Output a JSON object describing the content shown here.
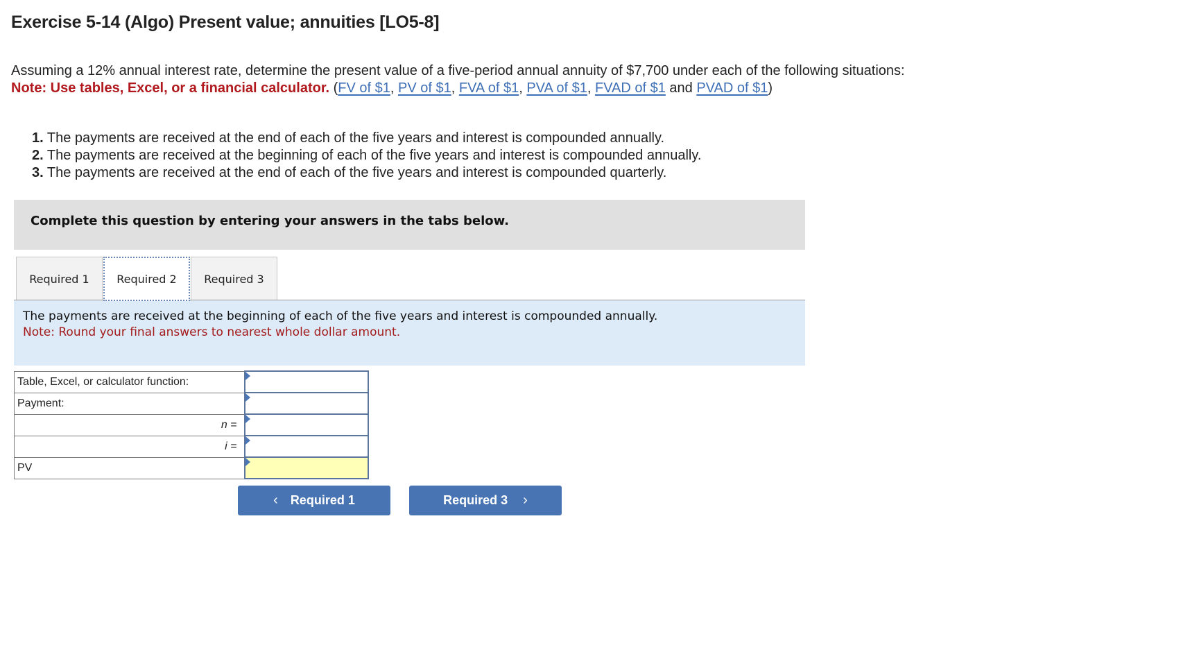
{
  "header": {
    "title": "Exercise 5-14 (Algo) Present value; annuities [LO5-8]"
  },
  "intro": {
    "text": "Assuming a 12% annual interest rate, determine the present value of a five-period annual annuity of $7,700 under each of the following situations:",
    "note_label": "Note: Use tables, Excel, or a financial calculator.",
    "open_paren": " (",
    "links": [
      "FV of $1",
      "PV of $1",
      "FVA of $1",
      "PVA of $1",
      "FVAD of $1",
      "PVAD of $1"
    ],
    "separator": ", ",
    "and_text": " and ",
    "close_paren": ")"
  },
  "requirements": [
    {
      "num": "1.",
      "text": " The payments are received at the end of each of the five years and interest is compounded annually."
    },
    {
      "num": "2.",
      "text": " The payments are received at the beginning of each of the five years and interest is compounded annually."
    },
    {
      "num": "3.",
      "text": " The payments are received at the end of each of the five years and interest is compounded quarterly."
    }
  ],
  "instruction_box": {
    "text": "Complete this question by entering your answers in the tabs below."
  },
  "tabs": [
    {
      "label": "Required 1",
      "active": false
    },
    {
      "label": "Required 2",
      "active": true
    },
    {
      "label": "Required 3",
      "active": false
    }
  ],
  "panel": {
    "description": "The payments are received at the beginning of each of the five years and interest is compounded annually.",
    "note": "Note: Round your final answers to nearest whole dollar amount."
  },
  "answer_table": {
    "rows": [
      {
        "label": "Table, Excel, or calculator function:",
        "value": ""
      },
      {
        "label": "Payment:",
        "value": ""
      },
      {
        "label": "n =",
        "value": ""
      },
      {
        "label": "i =",
        "value": ""
      },
      {
        "label": "PV",
        "value": ""
      }
    ]
  },
  "navigation": {
    "prev_label": "Required 1",
    "next_label": "Required 3",
    "prev_icon": "‹",
    "next_icon": "›"
  },
  "colors": {
    "link": "#3e6fb6",
    "note_red": "#b1191e",
    "button": "#4874b3",
    "panel_bg": "#ddeaf7",
    "result_cell_bg": "#ffffb7"
  }
}
